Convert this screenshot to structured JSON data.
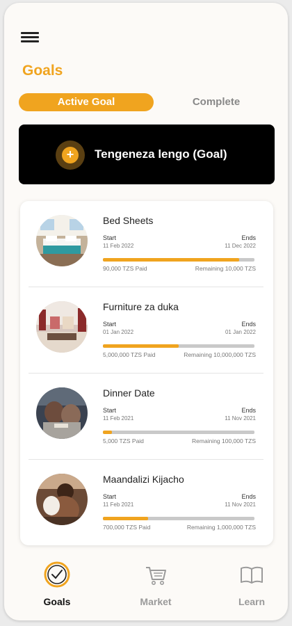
{
  "header": {
    "title": "Goals"
  },
  "tabs": {
    "active": "Active Goal",
    "inactive": "Complete"
  },
  "create_goal": {
    "label": "Tengeneza lengo (Goal)",
    "plus": "+"
  },
  "goal_labels": {
    "start": "Start",
    "ends": "Ends"
  },
  "goals": [
    {
      "title": "Bed Sheets",
      "start": "11 Feb 2022",
      "ends": "11 Dec 2022",
      "paid": "90,000 TZS Paid",
      "remaining": "Remaining 10,000 TZS",
      "progress": 0.9
    },
    {
      "title": "Furniture za duka",
      "start": "01 Jan 2022",
      "ends": "01 Jan 2022",
      "paid": "5,000,000 TZS Paid",
      "remaining": "Remaining 10,000,000 TZS",
      "progress": 0.5
    },
    {
      "title": "Dinner Date",
      "start": "11 Feb 2021",
      "ends": "11 Nov 2021",
      "paid": "5,000 TZS Paid",
      "remaining": "Remaining 100,000 TZS",
      "progress": 0.06
    },
    {
      "title": "Maandalizi Kijacho",
      "start": "11 Feb 2021",
      "ends": "11 Nov 2021",
      "paid": "700,000 TZS Paid",
      "remaining": "Remaining 1,000,000 TZS",
      "progress": 0.3
    }
  ],
  "nav": {
    "goals": {
      "label": "Goals",
      "icon": "check-circle-icon"
    },
    "market": {
      "label": "Market",
      "icon": "cart-icon"
    },
    "learn": {
      "label": "Learn",
      "icon": "book-icon"
    }
  },
  "colors": {
    "accent": "#f0a41f",
    "dark": "#000000",
    "muted": "#888888"
  }
}
